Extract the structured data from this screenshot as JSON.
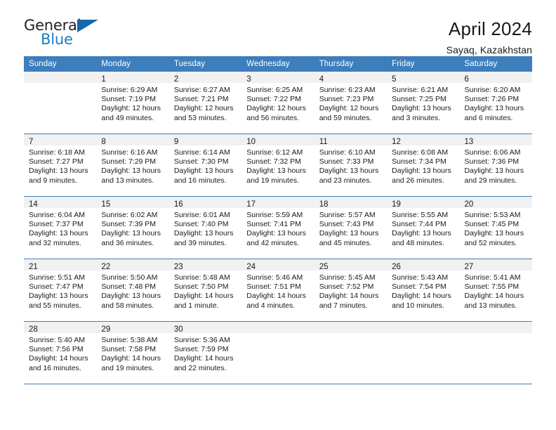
{
  "brand": {
    "line1": "General",
    "line2": "Blue",
    "logo_icon": "triangle-logo-icon"
  },
  "header": {
    "title": "April 2024",
    "subtitle": "Sayaq, Kazakhstan"
  },
  "calendar": {
    "weekday_headers": [
      "Sunday",
      "Monday",
      "Tuesday",
      "Wednesday",
      "Thursday",
      "Friday",
      "Saturday"
    ],
    "accent_color": "#3d7ebd",
    "daynum_band_color": "#f1f1f1",
    "weeks": [
      [
        {
          "day": "",
          "sunrise": "",
          "sunset": "",
          "daylight1": "",
          "daylight2": ""
        },
        {
          "day": "1",
          "sunrise": "Sunrise: 6:29 AM",
          "sunset": "Sunset: 7:19 PM",
          "daylight1": "Daylight: 12 hours",
          "daylight2": "and 49 minutes."
        },
        {
          "day": "2",
          "sunrise": "Sunrise: 6:27 AM",
          "sunset": "Sunset: 7:21 PM",
          "daylight1": "Daylight: 12 hours",
          "daylight2": "and 53 minutes."
        },
        {
          "day": "3",
          "sunrise": "Sunrise: 6:25 AM",
          "sunset": "Sunset: 7:22 PM",
          "daylight1": "Daylight: 12 hours",
          "daylight2": "and 56 minutes."
        },
        {
          "day": "4",
          "sunrise": "Sunrise: 6:23 AM",
          "sunset": "Sunset: 7:23 PM",
          "daylight1": "Daylight: 12 hours",
          "daylight2": "and 59 minutes."
        },
        {
          "day": "5",
          "sunrise": "Sunrise: 6:21 AM",
          "sunset": "Sunset: 7:25 PM",
          "daylight1": "Daylight: 13 hours",
          "daylight2": "and 3 minutes."
        },
        {
          "day": "6",
          "sunrise": "Sunrise: 6:20 AM",
          "sunset": "Sunset: 7:26 PM",
          "daylight1": "Daylight: 13 hours",
          "daylight2": "and 6 minutes."
        }
      ],
      [
        {
          "day": "7",
          "sunrise": "Sunrise: 6:18 AM",
          "sunset": "Sunset: 7:27 PM",
          "daylight1": "Daylight: 13 hours",
          "daylight2": "and 9 minutes."
        },
        {
          "day": "8",
          "sunrise": "Sunrise: 6:16 AM",
          "sunset": "Sunset: 7:29 PM",
          "daylight1": "Daylight: 13 hours",
          "daylight2": "and 13 minutes."
        },
        {
          "day": "9",
          "sunrise": "Sunrise: 6:14 AM",
          "sunset": "Sunset: 7:30 PM",
          "daylight1": "Daylight: 13 hours",
          "daylight2": "and 16 minutes."
        },
        {
          "day": "10",
          "sunrise": "Sunrise: 6:12 AM",
          "sunset": "Sunset: 7:32 PM",
          "daylight1": "Daylight: 13 hours",
          "daylight2": "and 19 minutes."
        },
        {
          "day": "11",
          "sunrise": "Sunrise: 6:10 AM",
          "sunset": "Sunset: 7:33 PM",
          "daylight1": "Daylight: 13 hours",
          "daylight2": "and 23 minutes."
        },
        {
          "day": "12",
          "sunrise": "Sunrise: 6:08 AM",
          "sunset": "Sunset: 7:34 PM",
          "daylight1": "Daylight: 13 hours",
          "daylight2": "and 26 minutes."
        },
        {
          "day": "13",
          "sunrise": "Sunrise: 6:06 AM",
          "sunset": "Sunset: 7:36 PM",
          "daylight1": "Daylight: 13 hours",
          "daylight2": "and 29 minutes."
        }
      ],
      [
        {
          "day": "14",
          "sunrise": "Sunrise: 6:04 AM",
          "sunset": "Sunset: 7:37 PM",
          "daylight1": "Daylight: 13 hours",
          "daylight2": "and 32 minutes."
        },
        {
          "day": "15",
          "sunrise": "Sunrise: 6:02 AM",
          "sunset": "Sunset: 7:39 PM",
          "daylight1": "Daylight: 13 hours",
          "daylight2": "and 36 minutes."
        },
        {
          "day": "16",
          "sunrise": "Sunrise: 6:01 AM",
          "sunset": "Sunset: 7:40 PM",
          "daylight1": "Daylight: 13 hours",
          "daylight2": "and 39 minutes."
        },
        {
          "day": "17",
          "sunrise": "Sunrise: 5:59 AM",
          "sunset": "Sunset: 7:41 PM",
          "daylight1": "Daylight: 13 hours",
          "daylight2": "and 42 minutes."
        },
        {
          "day": "18",
          "sunrise": "Sunrise: 5:57 AM",
          "sunset": "Sunset: 7:43 PM",
          "daylight1": "Daylight: 13 hours",
          "daylight2": "and 45 minutes."
        },
        {
          "day": "19",
          "sunrise": "Sunrise: 5:55 AM",
          "sunset": "Sunset: 7:44 PM",
          "daylight1": "Daylight: 13 hours",
          "daylight2": "and 48 minutes."
        },
        {
          "day": "20",
          "sunrise": "Sunrise: 5:53 AM",
          "sunset": "Sunset: 7:45 PM",
          "daylight1": "Daylight: 13 hours",
          "daylight2": "and 52 minutes."
        }
      ],
      [
        {
          "day": "21",
          "sunrise": "Sunrise: 5:51 AM",
          "sunset": "Sunset: 7:47 PM",
          "daylight1": "Daylight: 13 hours",
          "daylight2": "and 55 minutes."
        },
        {
          "day": "22",
          "sunrise": "Sunrise: 5:50 AM",
          "sunset": "Sunset: 7:48 PM",
          "daylight1": "Daylight: 13 hours",
          "daylight2": "and 58 minutes."
        },
        {
          "day": "23",
          "sunrise": "Sunrise: 5:48 AM",
          "sunset": "Sunset: 7:50 PM",
          "daylight1": "Daylight: 14 hours",
          "daylight2": "and 1 minute."
        },
        {
          "day": "24",
          "sunrise": "Sunrise: 5:46 AM",
          "sunset": "Sunset: 7:51 PM",
          "daylight1": "Daylight: 14 hours",
          "daylight2": "and 4 minutes."
        },
        {
          "day": "25",
          "sunrise": "Sunrise: 5:45 AM",
          "sunset": "Sunset: 7:52 PM",
          "daylight1": "Daylight: 14 hours",
          "daylight2": "and 7 minutes."
        },
        {
          "day": "26",
          "sunrise": "Sunrise: 5:43 AM",
          "sunset": "Sunset: 7:54 PM",
          "daylight1": "Daylight: 14 hours",
          "daylight2": "and 10 minutes."
        },
        {
          "day": "27",
          "sunrise": "Sunrise: 5:41 AM",
          "sunset": "Sunset: 7:55 PM",
          "daylight1": "Daylight: 14 hours",
          "daylight2": "and 13 minutes."
        }
      ],
      [
        {
          "day": "28",
          "sunrise": "Sunrise: 5:40 AM",
          "sunset": "Sunset: 7:56 PM",
          "daylight1": "Daylight: 14 hours",
          "daylight2": "and 16 minutes."
        },
        {
          "day": "29",
          "sunrise": "Sunrise: 5:38 AM",
          "sunset": "Sunset: 7:58 PM",
          "daylight1": "Daylight: 14 hours",
          "daylight2": "and 19 minutes."
        },
        {
          "day": "30",
          "sunrise": "Sunrise: 5:36 AM",
          "sunset": "Sunset: 7:59 PM",
          "daylight1": "Daylight: 14 hours",
          "daylight2": "and 22 minutes."
        },
        {
          "day": "",
          "sunrise": "",
          "sunset": "",
          "daylight1": "",
          "daylight2": ""
        },
        {
          "day": "",
          "sunrise": "",
          "sunset": "",
          "daylight1": "",
          "daylight2": ""
        },
        {
          "day": "",
          "sunrise": "",
          "sunset": "",
          "daylight1": "",
          "daylight2": ""
        },
        {
          "day": "",
          "sunrise": "",
          "sunset": "",
          "daylight1": "",
          "daylight2": ""
        }
      ]
    ]
  }
}
